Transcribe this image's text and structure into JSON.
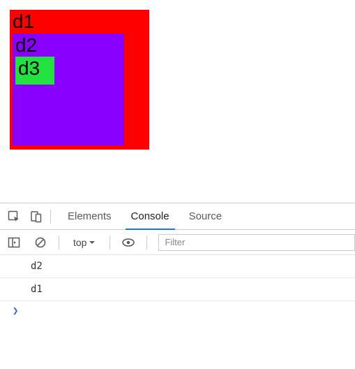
{
  "page": {
    "d1": "d1",
    "d2": "d2",
    "d3": "d3"
  },
  "devtools": {
    "tabs": {
      "elements": "Elements",
      "console": "Console",
      "sources": "Source"
    },
    "toolbar": {
      "context": "top",
      "filter_placeholder": "Filter"
    },
    "log_entries": [
      "d2",
      "d1"
    ],
    "prompt": "❯"
  }
}
